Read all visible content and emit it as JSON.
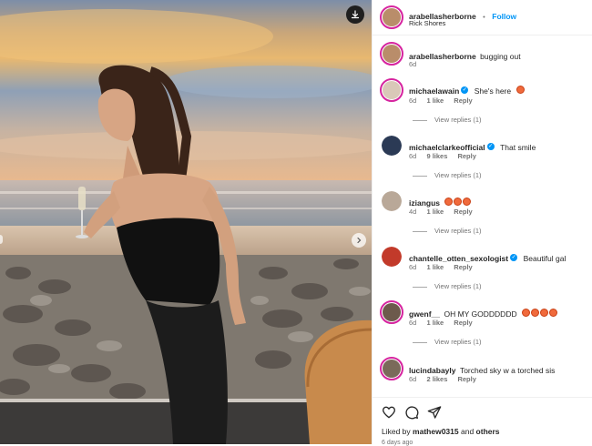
{
  "header": {
    "username": "arabellasherborne",
    "separator": "•",
    "follow_label": "Follow",
    "location": "Rick Shores"
  },
  "caption": {
    "username": "arabellasherborne",
    "text": "bugging out",
    "time": "6d"
  },
  "comments": [
    {
      "username": "michaelawain",
      "verified": true,
      "text": "She's here",
      "emoji_count": 1,
      "time": "6d",
      "likes": "1 like",
      "reply": "Reply",
      "view_replies": "View replies (1)",
      "avatar_color": "#d9c8b8"
    },
    {
      "username": "michaelclarkeofficial",
      "verified": true,
      "text": "That smile",
      "emoji_count": 0,
      "time": "6d",
      "likes": "9 likes",
      "reply": "Reply",
      "view_replies": "View replies (1)",
      "avatar_color": "#2b3a55"
    },
    {
      "username": "iziangus",
      "verified": false,
      "text": "",
      "emoji_count": 3,
      "time": "4d",
      "likes": "1 like",
      "reply": "Reply",
      "view_replies": "View replies (1)",
      "avatar_color": "#b9a898"
    },
    {
      "username": "chantelle_otten_sexologist",
      "verified": true,
      "text": "Beautiful gal",
      "emoji_count": 0,
      "time": "6d",
      "likes": "1 like",
      "reply": "Reply",
      "view_replies": "View replies (1)",
      "avatar_color": "#c23a2a"
    },
    {
      "username": "gwenf__",
      "verified": false,
      "text": "OH MY GODDDDDD",
      "emoji_count": 4,
      "time": "6d",
      "likes": "1 like",
      "reply": "Reply",
      "view_replies": "View replies (1)",
      "avatar_color": "#6d5a4c"
    },
    {
      "username": "lucindabayly",
      "verified": false,
      "text": "Torched sky w a torched sis",
      "emoji_count": 0,
      "time": "6d",
      "likes": "2 likes",
      "reply": "Reply",
      "view_replies": "",
      "avatar_color": "#7a6a5a"
    }
  ],
  "footer": {
    "liked_by_prefix": "Liked by",
    "liked_by_user": "mathew0315",
    "and_label": "and",
    "others_label": "others",
    "ago": "6 days ago"
  },
  "icons": {
    "download": "download-icon",
    "next": "chevron-right-icon",
    "like": "heart-icon",
    "comment": "comment-icon",
    "share": "paper-plane-icon",
    "verified": "verified-badge-icon"
  },
  "colors": {
    "link_blue": "#0095f6",
    "story_ring": "#d6249f",
    "muted_text": "#737373"
  }
}
